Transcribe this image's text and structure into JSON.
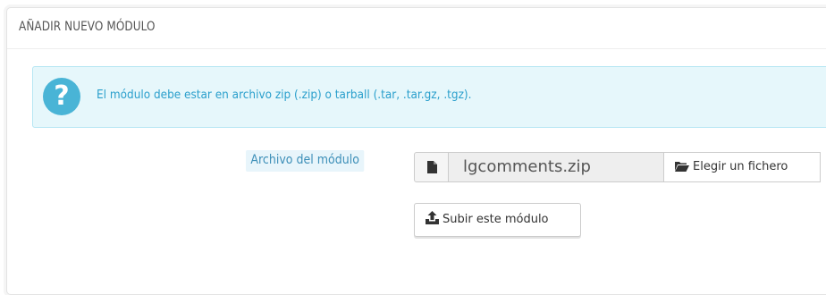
{
  "panel": {
    "title": "AÑADIR NUEVO MÓDULO"
  },
  "alert": {
    "icon": "question-circle-icon",
    "text": "El módulo debe estar en archivo zip (.zip) o tarball (.tar, .tar.gz, .tgz)."
  },
  "form": {
    "file_label": "Archivo del módulo",
    "file_icon": "file-icon",
    "file_value": "lgcomments.zip",
    "choose_button_icon": "folder-open-icon",
    "choose_button_label": "Elegir un fichero",
    "upload_button_icon": "upload-icon",
    "upload_button_label": "Subir este módulo"
  },
  "colors": {
    "alert_background": "#e6f7fb",
    "alert_text": "#2a9fcc",
    "alert_icon": "#49b4d6",
    "label_text": "#3d8fb8"
  }
}
